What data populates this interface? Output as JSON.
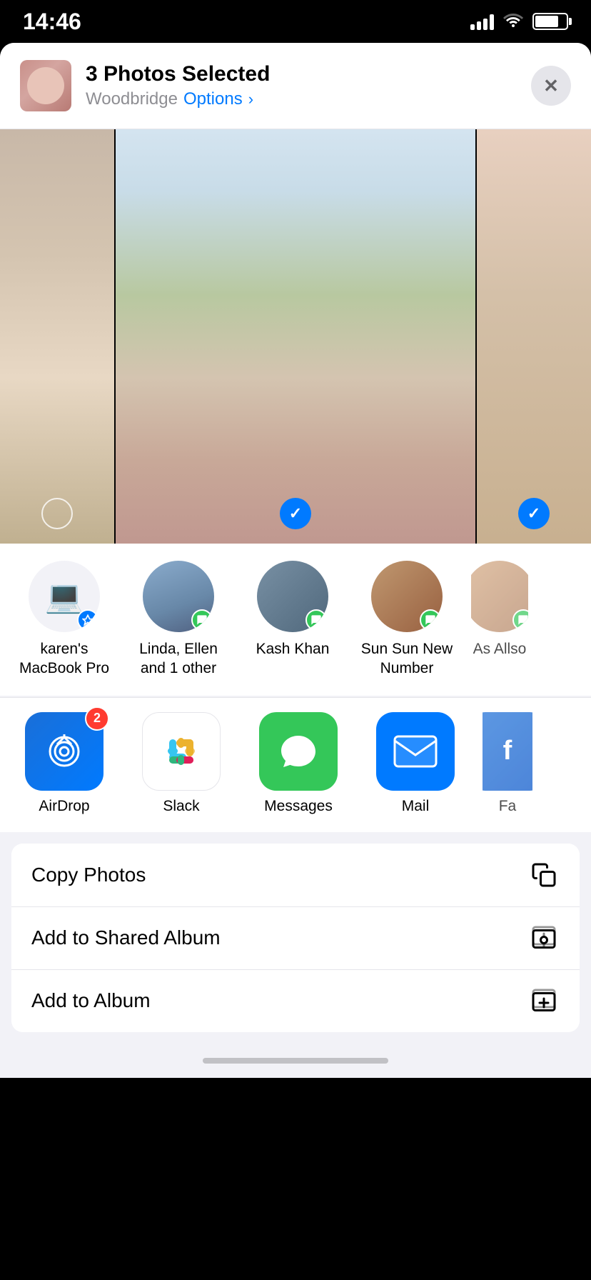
{
  "statusBar": {
    "time": "14:46"
  },
  "header": {
    "title": "3 Photos Selected",
    "album": "Woodbridge",
    "optionsLabel": "Options",
    "closeLabel": "✕"
  },
  "people": [
    {
      "name": "karen's MacBook Pro",
      "type": "airdrop"
    },
    {
      "name": "Linda, Ellen and 1 other",
      "type": "messages"
    },
    {
      "name": "Kash Khan",
      "type": "messages"
    },
    {
      "name": "Sun Sun New Number",
      "type": "messages"
    },
    {
      "name": "As Allso",
      "type": "messages",
      "partial": true
    }
  ],
  "apps": [
    {
      "name": "AirDrop",
      "type": "airdrop",
      "badge": "2"
    },
    {
      "name": "Slack",
      "type": "slack",
      "badge": null
    },
    {
      "name": "Messages",
      "type": "messages",
      "badge": null
    },
    {
      "name": "Mail",
      "type": "mail",
      "badge": null
    },
    {
      "name": "Fa",
      "type": "partial",
      "badge": null
    }
  ],
  "actions": [
    {
      "label": "Copy Photos",
      "icon": "copy"
    },
    {
      "label": "Add to Shared Album",
      "icon": "shared-album"
    },
    {
      "label": "Add to Album",
      "icon": "add-album"
    }
  ]
}
